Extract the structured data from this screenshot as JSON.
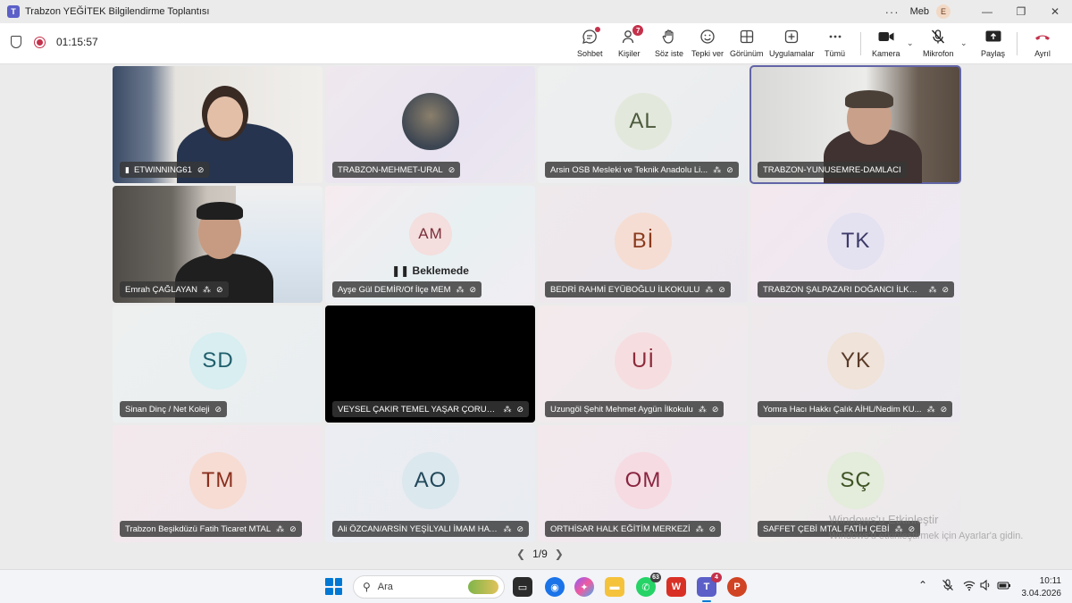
{
  "window": {
    "title": "Trabzon YEĞİTEK Bilgilendirme Toplantısı",
    "user": "Meb",
    "avatar_initial": "E",
    "more": "···",
    "minimize": "—",
    "restore": "❐",
    "close": "✕"
  },
  "meeting": {
    "timer": "01:15:57"
  },
  "toolbar": {
    "chat": "Sohbet",
    "people": "Kişiler",
    "people_badge": "7",
    "raise_hand": "Söz iste",
    "react": "Tepki ver",
    "view": "Görünüm",
    "apps": "Uygulamalar",
    "more": "Tümü",
    "camera": "Kamera",
    "mic": "Mikrofon",
    "share": "Paylaş",
    "leave": "Ayrıl"
  },
  "tiles": [
    {
      "name": "ETWINNING61",
      "type": "video"
    },
    {
      "name": "TRABZON-MEHMET-URAL",
      "type": "photo"
    },
    {
      "name": "Arsin OSB Mesleki ve Teknik Anadolu Li...",
      "initials": "AL"
    },
    {
      "name": "TRABZON-YUNUSEMRE-DAMLACI",
      "type": "video"
    },
    {
      "name": "Emrah ÇAĞLAYAN",
      "type": "video"
    },
    {
      "name": "Ayşe Gül DEMİR/Of İlçe MEM",
      "initials": "AM",
      "status": "Beklemede"
    },
    {
      "name": "BEDRİ RAHMİ EYÜBOĞLU İLKOKULU",
      "initials": "Bİ"
    },
    {
      "name": "TRABZON ŞALPAZARI DOĞANCI İLKOK...",
      "initials": "TK"
    },
    {
      "name": "Sinan Dinç / Net Koleji",
      "initials": "SD"
    },
    {
      "name": "VEYSEL ÇAKIR TEMEL YAŞAR ÇORUH İL...",
      "type": "black"
    },
    {
      "name": "Uzungöl Şehit Mehmet Aygün İlkokulu",
      "initials": "Uİ"
    },
    {
      "name": "Yomra Hacı Hakkı Çalık AİHL/Nedim KU...",
      "initials": "YK"
    },
    {
      "name": "Trabzon Beşikdüzü Fatih Ticaret MTAL",
      "initials": "TM"
    },
    {
      "name": "Ali ÖZCAN/ARSİN YEŞİLYALI İMAM HATİ...",
      "initials": "AO"
    },
    {
      "name": "ORTHİSAR HALK EĞİTİM MERKEZİ",
      "initials": "OM"
    },
    {
      "name": "SAFFET ÇEBİ MTAL FATİH ÇEBİ",
      "initials": "SÇ"
    }
  ],
  "pager": {
    "label": "1/9"
  },
  "watermark": {
    "line1": "Windows'u Etkinleştir",
    "line2": "Windows'u etkinleştirmek için Ayarlar'a gidin."
  },
  "taskbar": {
    "search_placeholder": "Ara",
    "whatsapp_badge": "63",
    "teams_badge": "4",
    "time": "10:11",
    "date": "3.04.2026"
  },
  "colors": {
    "accent": "#6264a7",
    "leave": "#c4314b",
    "taskbar_bg": "#f2f4f8"
  }
}
